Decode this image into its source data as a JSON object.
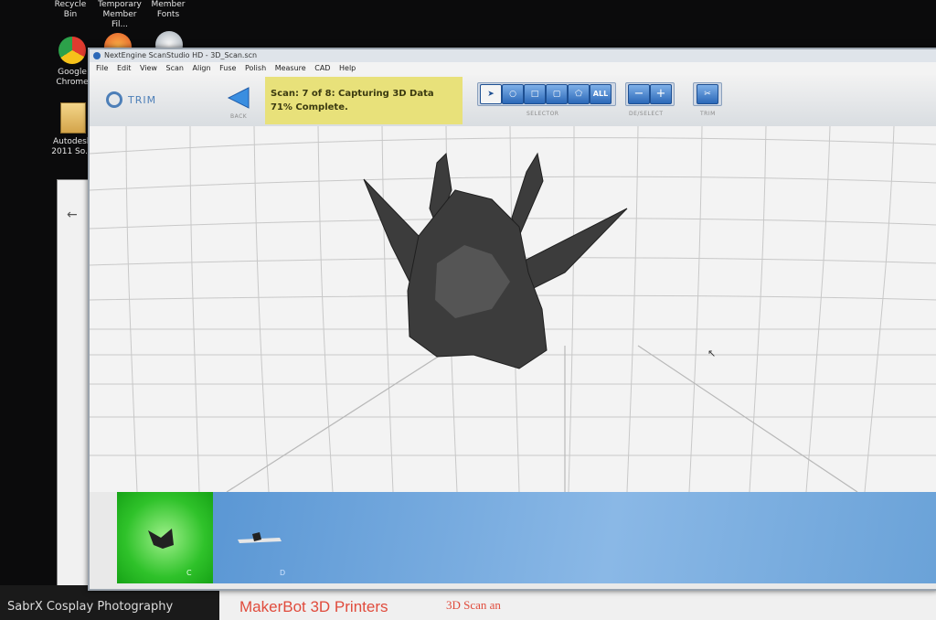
{
  "desktop": {
    "icons": [
      {
        "label": "Recycle Bin",
        "name": "recycle-bin-icon"
      },
      {
        "label": "Temporary Member Fil...",
        "name": "folder-icon"
      },
      {
        "label": "Member Fonts",
        "name": "folder-icon"
      },
      {
        "label": "Google Chrome",
        "name": "chrome-icon"
      },
      {
        "label": "Autodesk 2011 So...",
        "name": "autodesk-folder-icon"
      }
    ]
  },
  "app": {
    "title": "NextEngine ScanStudio HD - 3D_Scan.scn",
    "menu": [
      "File",
      "Edit",
      "View",
      "Scan",
      "Align",
      "Fuse",
      "Polish",
      "Measure",
      "CAD",
      "Help"
    ],
    "toolbar": {
      "trim_label": "TRIM",
      "back_label": "BACK",
      "selector_caption": "SELECTOR",
      "deselect_caption": "DE/SELECT",
      "trim_caption": "TRIM",
      "all_label": "ALL",
      "minus_label": "−",
      "plus_label": "+"
    },
    "status": {
      "line1": "Scan: 7 of 8: Capturing 3D Data",
      "line2": "71% Complete.",
      "progress_fraction": 0.71
    },
    "scan_strip": {
      "thumb_labels": [
        "C",
        "D"
      ]
    }
  },
  "footer": {
    "watermark": "SabrX Cosplay Photography",
    "ad_primary": "MakerBot 3D Printers",
    "ad_secondary": "3D Scan an"
  },
  "colors": {
    "status_bg": "#e8e17a",
    "accent_blue": "#2b68b8",
    "thumb_green": "#2fc22a"
  }
}
